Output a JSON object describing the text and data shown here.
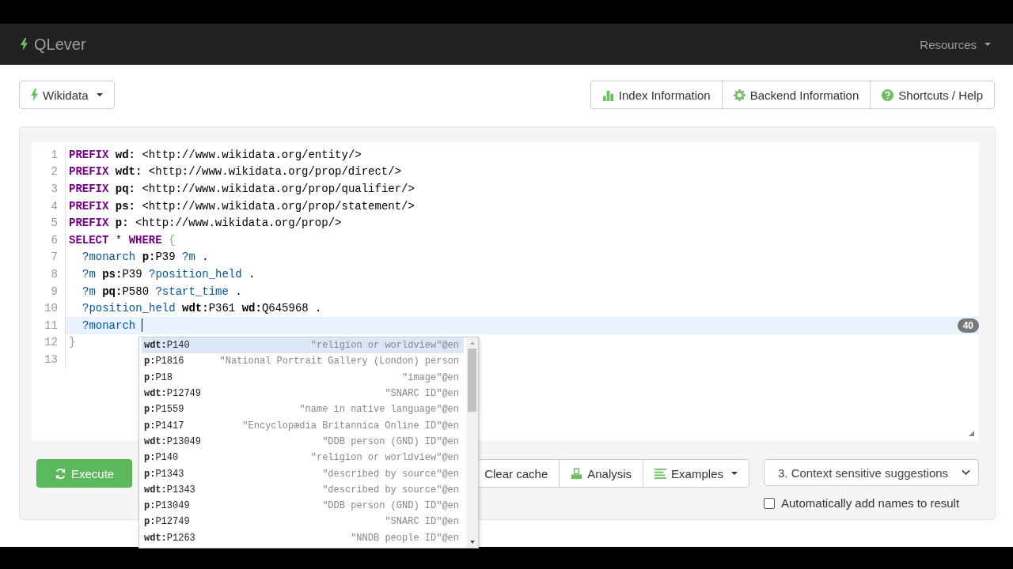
{
  "navbar": {
    "brand": "QLever",
    "menu": "Resources"
  },
  "backend_button": "Wikidata",
  "info_buttons": [
    {
      "kind": "index",
      "label": "Index Information"
    },
    {
      "kind": "backend",
      "label": "Backend Information"
    },
    {
      "kind": "help",
      "label": "Shortcuts / Help"
    }
  ],
  "editor": {
    "lines": [
      {
        "number": "1",
        "current": false,
        "indented": false,
        "tokens": [
          {
            "kind": "kw",
            "text": "PREFIX "
          },
          {
            "kind": "pfx",
            "text": "wd:"
          },
          {
            "kind": "txt",
            "text": " <http://www.wikidata.org/entity/>"
          }
        ]
      },
      {
        "number": "2",
        "current": false,
        "indented": false,
        "tokens": [
          {
            "kind": "kw",
            "text": "PREFIX "
          },
          {
            "kind": "pfx",
            "text": "wdt:"
          },
          {
            "kind": "txt",
            "text": " <http://www.wikidata.org/prop/direct/>"
          }
        ]
      },
      {
        "number": "3",
        "current": false,
        "indented": false,
        "tokens": [
          {
            "kind": "kw",
            "text": "PREFIX "
          },
          {
            "kind": "pfx",
            "text": "pq:"
          },
          {
            "kind": "txt",
            "text": " <http://www.wikidata.org/prop/qualifier/>"
          }
        ]
      },
      {
        "number": "4",
        "current": false,
        "indented": false,
        "tokens": [
          {
            "kind": "kw",
            "text": "PREFIX "
          },
          {
            "kind": "pfx",
            "text": "ps:"
          },
          {
            "kind": "txt",
            "text": " <http://www.wikidata.org/prop/statement/>"
          }
        ]
      },
      {
        "number": "5",
        "current": false,
        "indented": false,
        "tokens": [
          {
            "kind": "kw",
            "text": "PREFIX "
          },
          {
            "kind": "pfx",
            "text": "p:"
          },
          {
            "kind": "txt",
            "text": " <http://www.wikidata.org/prop/>"
          }
        ]
      },
      {
        "number": "6",
        "current": false,
        "indented": false,
        "tokens": [
          {
            "kind": "kw",
            "text": "SELECT"
          },
          {
            "kind": "txt",
            "text": " * "
          },
          {
            "kind": "kw",
            "text": "WHERE "
          },
          {
            "kind": "brace",
            "text": "{"
          }
        ]
      },
      {
        "number": "7",
        "current": false,
        "indented": true,
        "tokens": [
          {
            "kind": "var",
            "text": "?monarch "
          },
          {
            "kind": "pfx",
            "text": "p:"
          },
          {
            "kind": "txt",
            "text": "P39 "
          },
          {
            "kind": "var",
            "text": "?m"
          },
          {
            "kind": "txt",
            "text": " ."
          }
        ]
      },
      {
        "number": "8",
        "current": false,
        "indented": true,
        "tokens": [
          {
            "kind": "var",
            "text": "?m "
          },
          {
            "kind": "pfx",
            "text": "ps:"
          },
          {
            "kind": "txt",
            "text": "P39 "
          },
          {
            "kind": "var",
            "text": "?position_held"
          },
          {
            "kind": "txt",
            "text": " ."
          }
        ]
      },
      {
        "number": "9",
        "current": false,
        "indented": true,
        "tokens": [
          {
            "kind": "var",
            "text": "?m "
          },
          {
            "kind": "pfx",
            "text": "pq:"
          },
          {
            "kind": "txt",
            "text": "P580 "
          },
          {
            "kind": "var",
            "text": "?start_time"
          },
          {
            "kind": "txt",
            "text": " ."
          }
        ]
      },
      {
        "number": "10",
        "current": false,
        "indented": true,
        "tokens": [
          {
            "kind": "var",
            "text": "?position_held "
          },
          {
            "kind": "pfx",
            "text": "wdt:"
          },
          {
            "kind": "txt",
            "text": "P361 "
          },
          {
            "kind": "pfx",
            "text": "wd:"
          },
          {
            "kind": "txt",
            "text": "Q645968 ."
          }
        ]
      },
      {
        "number": "11",
        "current": true,
        "indented": true,
        "badge": "40",
        "tokens": [
          {
            "kind": "var",
            "text": "?monarch"
          }
        ]
      },
      {
        "number": "12",
        "current": false,
        "indented": false,
        "tokens": [
          {
            "kind": "brace",
            "text": "}"
          }
        ]
      },
      {
        "number": "13",
        "current": false
      }
    ]
  },
  "suggestions": [
    {
      "prefix": "wdt:",
      "id": "P140",
      "label": "\"religion or worldview\"@en",
      "selected": true
    },
    {
      "prefix": "p:",
      "id": "P1816",
      "label": "\"National Portrait Gallery (London) person",
      "selected": false
    },
    {
      "prefix": "p:",
      "id": "P18",
      "label": "\"image\"@en",
      "selected": false
    },
    {
      "prefix": "wdt:",
      "id": "P12749",
      "label": "\"SNARC ID\"@en",
      "selected": false
    },
    {
      "prefix": "p:",
      "id": "P1559",
      "label": "\"name in native language\"@en",
      "selected": false
    },
    {
      "prefix": "p:",
      "id": "P1417",
      "label": "\"Encyclopædia Britannica Online ID\"@en",
      "selected": false
    },
    {
      "prefix": "wdt:",
      "id": "P13049",
      "label": "\"DDB person (GND) ID\"@en",
      "selected": false
    },
    {
      "prefix": "p:",
      "id": "P140",
      "label": "\"religion or worldview\"@en",
      "selected": false
    },
    {
      "prefix": "p:",
      "id": "P1343",
      "label": "\"described by source\"@en",
      "selected": false
    },
    {
      "prefix": "wdt:",
      "id": "P1343",
      "label": "\"described by source\"@en",
      "selected": false
    },
    {
      "prefix": "p:",
      "id": "P13049",
      "label": "\"DDB person (GND) ID\"@en",
      "selected": false
    },
    {
      "prefix": "p:",
      "id": "P12749",
      "label": "\"SNARC ID\"@en",
      "selected": false
    },
    {
      "prefix": "wdt:",
      "id": "P1263",
      "label": "\"NNDB people ID\"@en",
      "selected": false
    }
  ],
  "toolbar": {
    "execute": "Execute",
    "buttons": [
      {
        "kind": "clear",
        "label": "Clear cache"
      },
      {
        "kind": "analysis",
        "label": "Analysis"
      },
      {
        "kind": "examples",
        "label": "Examples"
      }
    ]
  },
  "mode_select": {
    "value": "3. Context sensitive suggestions"
  },
  "auto_names": {
    "label": "Automatically add names to result",
    "checked": false
  }
}
